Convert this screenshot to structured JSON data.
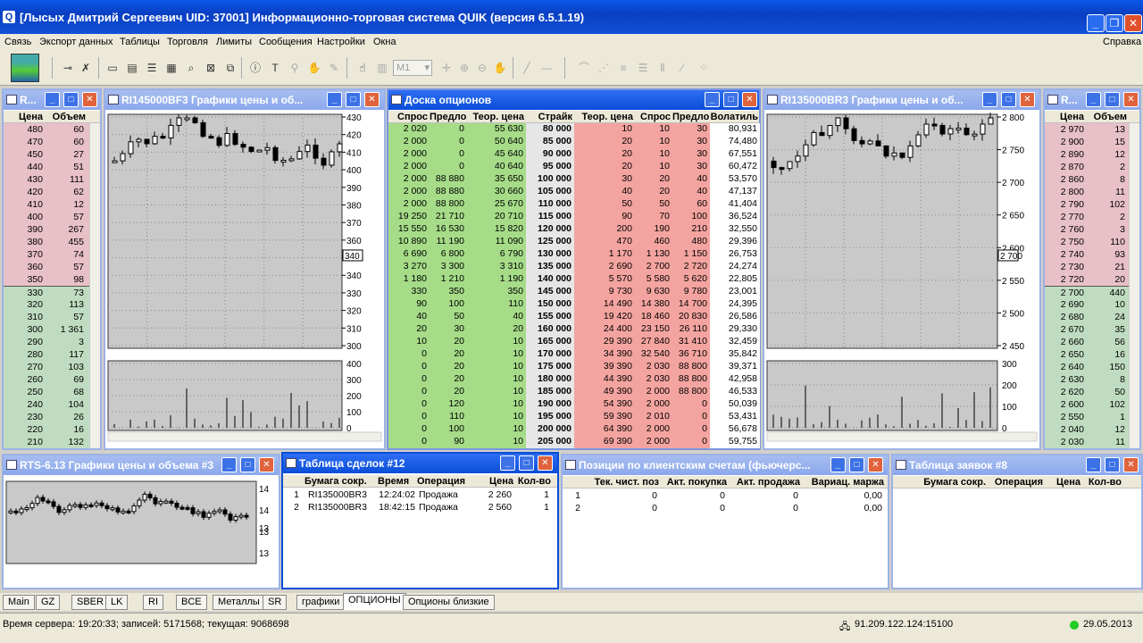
{
  "app": {
    "title": "[Лысых Дмитрий Сергеевич  UID: 37001] Информационно-торговая система QUIK (версия 6.5.1.19)"
  },
  "menu": [
    "Связь",
    "Экспорт данных",
    "Таблицы",
    "Торговля",
    "Лимиты",
    "Сообщения",
    "Настройки",
    "Окна"
  ],
  "menu_help": "Справка",
  "ob_left": {
    "title": "R...",
    "headers": {
      "price": "Цена",
      "volume": "Объем"
    },
    "sell": [
      [
        "480",
        "60"
      ],
      [
        "470",
        "60"
      ],
      [
        "450",
        "27"
      ],
      [
        "440",
        "51"
      ],
      [
        "430",
        "111"
      ],
      [
        "420",
        "62"
      ],
      [
        "410",
        "12"
      ],
      [
        "400",
        "57"
      ],
      [
        "390",
        "267"
      ],
      [
        "380",
        "455"
      ],
      [
        "370",
        "74"
      ],
      [
        "360",
        "57"
      ],
      [
        "350",
        "98"
      ]
    ],
    "buy": [
      [
        "330",
        "73"
      ],
      [
        "320",
        "113"
      ],
      [
        "310",
        "57"
      ],
      [
        "300",
        "1 361"
      ],
      [
        "290",
        "3"
      ],
      [
        "280",
        "117"
      ],
      [
        "270",
        "103"
      ],
      [
        "260",
        "69"
      ],
      [
        "250",
        "68"
      ],
      [
        "240",
        "104"
      ],
      [
        "230",
        "26"
      ],
      [
        "220",
        "16"
      ],
      [
        "210",
        "132"
      ]
    ]
  },
  "chart1": {
    "title": "RI145000BF3 Графики цены и об...",
    "price_ticks": [
      "430",
      "420",
      "410",
      "400",
      "390",
      "380",
      "370",
      "360",
      "350",
      "340",
      "330",
      "320",
      "310",
      "300"
    ],
    "last_label": "340",
    "vol_ticks": [
      "400",
      "300",
      "200",
      "100",
      "0"
    ]
  },
  "options": {
    "title": "Доска опционов",
    "headers": [
      "Спрос",
      "Предло",
      "Теор. цена",
      "Страйк",
      "Теор. цена",
      "Спрос",
      "Предло",
      "Волатиль"
    ],
    "rows": [
      [
        "2 020",
        "0",
        "55 630",
        "80 000",
        "10",
        "10",
        "30",
        "80,931"
      ],
      [
        "2 000",
        "0",
        "50 640",
        "85 000",
        "20",
        "10",
        "30",
        "74,480"
      ],
      [
        "2 000",
        "0",
        "45 640",
        "90 000",
        "20",
        "10",
        "30",
        "67,551"
      ],
      [
        "2 000",
        "0",
        "40 640",
        "95 000",
        "20",
        "10",
        "30",
        "60,472"
      ],
      [
        "2 000",
        "88 880",
        "35 650",
        "100 000",
        "30",
        "20",
        "40",
        "53,570"
      ],
      [
        "2 000",
        "88 880",
        "30 660",
        "105 000",
        "40",
        "20",
        "40",
        "47,137"
      ],
      [
        "2 000",
        "88 800",
        "25 670",
        "110 000",
        "50",
        "50",
        "60",
        "41,404"
      ],
      [
        "19 250",
        "21 710",
        "20 710",
        "115 000",
        "90",
        "70",
        "100",
        "36,524"
      ],
      [
        "15 550",
        "16 530",
        "15 820",
        "120 000",
        "200",
        "190",
        "210",
        "32,550"
      ],
      [
        "10 890",
        "11 190",
        "11 090",
        "125 000",
        "470",
        "460",
        "480",
        "29,396"
      ],
      [
        "6 690",
        "6 800",
        "6 790",
        "130 000",
        "1 170",
        "1 130",
        "1 150",
        "26,753"
      ],
      [
        "3 270",
        "3 300",
        "3 310",
        "135 000",
        "2 690",
        "2 700",
        "2 720",
        "24,274"
      ],
      [
        "1 180",
        "1 210",
        "1 190",
        "140 000",
        "5 570",
        "5 580",
        "5 620",
        "22,805"
      ],
      [
        "330",
        "350",
        "350",
        "145 000",
        "9 730",
        "9 630",
        "9 780",
        "23,001"
      ],
      [
        "90",
        "100",
        "110",
        "150 000",
        "14 490",
        "14 380",
        "14 700",
        "24,395"
      ],
      [
        "40",
        "50",
        "40",
        "155 000",
        "19 420",
        "18 460",
        "20 830",
        "26,586"
      ],
      [
        "20",
        "30",
        "20",
        "160 000",
        "24 400",
        "23 150",
        "26 110",
        "29,330"
      ],
      [
        "10",
        "20",
        "10",
        "165 000",
        "29 390",
        "27 840",
        "31 410",
        "32,459"
      ],
      [
        "0",
        "20",
        "10",
        "170 000",
        "34 390",
        "32 540",
        "36 710",
        "35,842"
      ],
      [
        "0",
        "20",
        "10",
        "175 000",
        "39 390",
        "2 030",
        "88 800",
        "39,371"
      ],
      [
        "0",
        "20",
        "10",
        "180 000",
        "44 390",
        "2 030",
        "88 800",
        "42,958"
      ],
      [
        "0",
        "20",
        "10",
        "185 000",
        "49 390",
        "2 000",
        "88 800",
        "46,533"
      ],
      [
        "0",
        "120",
        "10",
        "190 000",
        "54 390",
        "2 000",
        "0",
        "50,039"
      ],
      [
        "0",
        "110",
        "10",
        "195 000",
        "59 390",
        "2 010",
        "0",
        "53,431"
      ],
      [
        "0",
        "100",
        "10",
        "200 000",
        "64 390",
        "2 000",
        "0",
        "56,678"
      ],
      [
        "0",
        "90",
        "10",
        "205 000",
        "69 390",
        "2 000",
        "0",
        "59,755"
      ]
    ]
  },
  "chart2": {
    "title": "RI135000BR3 Графики цены и об...",
    "price_ticks": [
      "2 800",
      "2 750",
      "2 700",
      "2 650",
      "2 600",
      "2 550",
      "2 500",
      "2 450"
    ],
    "last_label": "2 700",
    "vol_ticks": [
      "300",
      "200",
      "100",
      "0"
    ]
  },
  "ob_right": {
    "title": "R...",
    "headers": {
      "price": "Цена",
      "volume": "Объем"
    },
    "sell": [
      [
        "2 970",
        "13"
      ],
      [
        "2 900",
        "15"
      ],
      [
        "2 890",
        "12"
      ],
      [
        "2 870",
        "2"
      ],
      [
        "2 860",
        "8"
      ],
      [
        "2 800",
        "11"
      ],
      [
        "2 790",
        "102"
      ],
      [
        "2 770",
        "2"
      ],
      [
        "2 760",
        "3"
      ],
      [
        "2 750",
        "110"
      ],
      [
        "2 740",
        "93"
      ],
      [
        "2 730",
        "21"
      ],
      [
        "2 720",
        "20"
      ]
    ],
    "buy": [
      [
        "2 700",
        "440"
      ],
      [
        "2 690",
        "10"
      ],
      [
        "2 680",
        "24"
      ],
      [
        "2 670",
        "35"
      ],
      [
        "2 660",
        "56"
      ],
      [
        "2 650",
        "16"
      ],
      [
        "2 640",
        "150"
      ],
      [
        "2 630",
        "8"
      ],
      [
        "2 620",
        "50"
      ],
      [
        "2 600",
        "102"
      ],
      [
        "2 550",
        "1"
      ],
      [
        "2 040",
        "12"
      ],
      [
        "2 030",
        "11"
      ]
    ]
  },
  "chart3": {
    "title": "RTS-6.13 Графики цены и объема #3",
    "ticks": [
      "14",
      "14",
      "13",
      "13"
    ],
    "last_label": "13"
  },
  "deals": {
    "title": "Таблица сделок #12",
    "headers": [
      "Бумага сокр.",
      "Время",
      "Операция",
      "Цена",
      "Кол-во"
    ],
    "rows": [
      [
        "1",
        "RI135000BR3",
        "12:24:02",
        "Продажа",
        "2 260",
        "1"
      ],
      [
        "2",
        "RI135000BR3",
        "18:42:15",
        "Продажа",
        "2 560",
        "1"
      ]
    ]
  },
  "positions": {
    "title": "Позиции по клиентским счетам (фьючерс...",
    "headers": [
      "Тек. чист. поз",
      "Акт. покупка",
      "Акт. продажа",
      "Вариац. маржа"
    ],
    "rows": [
      [
        "1",
        "0",
        "0",
        "0",
        "0,00"
      ],
      [
        "2",
        "0",
        "0",
        "0",
        "0,00"
      ]
    ]
  },
  "orders": {
    "title": "Таблица заявок #8",
    "headers": [
      "Бумага сокр.",
      "Операция",
      "Цена",
      "Кол-во"
    ]
  },
  "tabs": [
    "Main",
    "GZ",
    "SBER",
    "LK",
    "RI",
    "BCE",
    "Металлы",
    "SR",
    "графики",
    "ОПЦИОНЫ",
    "Опционы близкие"
  ],
  "tab_selected": "ОПЦИОНЫ",
  "status": {
    "server": "Время сервера: 19:20:33; записей: 5171568; текущая: 9068698",
    "ip": "91.209.122.124:15100",
    "date": "29.05.2013"
  },
  "toolbar": {
    "zoom_select": "M1"
  },
  "colors": {
    "sell_bg": "#e8c0c8",
    "buy_bg": "#c0dcc0",
    "call_bg": "#a6dc88",
    "put_bg": "#f4a4a0",
    "strike_bg": "#e6e6e6",
    "chart_bg": "#c9c9c9"
  }
}
